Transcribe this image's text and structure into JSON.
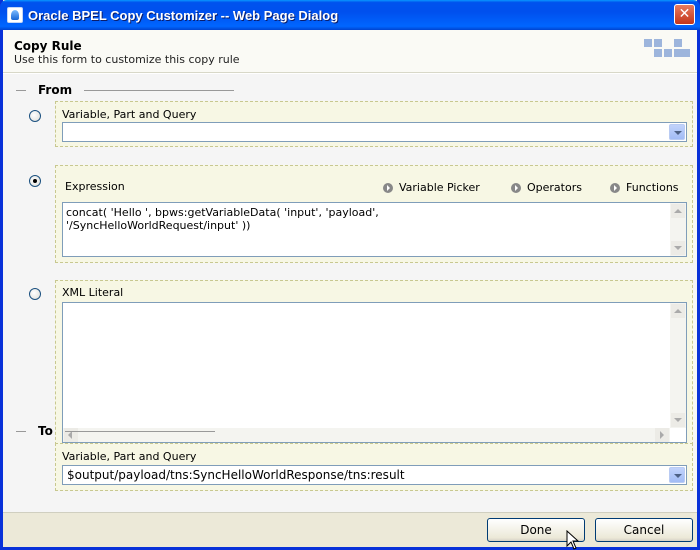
{
  "window": {
    "title": "Oracle BPEL Copy Customizer -- Web Page Dialog",
    "close_symbol": "✕"
  },
  "header": {
    "title": "Copy Rule",
    "subtitle": "Use this form to customize this copy rule"
  },
  "from": {
    "legend": "From",
    "variable": {
      "label": "Variable, Part and Query",
      "value": "",
      "selected": false
    },
    "expression": {
      "label": "Expression",
      "selected": true,
      "links": {
        "variable_picker": "Variable Picker",
        "operators": "Operators",
        "functions": "Functions"
      },
      "line1": "concat( 'Hello ', bpws:getVariableData( 'input', 'payload',",
      "line2": "'/SyncHelloWorldRequest/input' ))"
    },
    "xml_literal": {
      "label": "XML Literal",
      "value": "",
      "selected": false
    }
  },
  "to": {
    "legend": "To",
    "variable": {
      "label": "Variable, Part and Query",
      "value": "$output/payload/tns:SyncHelloWorldResponse/tns:result"
    }
  },
  "buttons": {
    "done": "Done",
    "cancel": "Cancel"
  }
}
